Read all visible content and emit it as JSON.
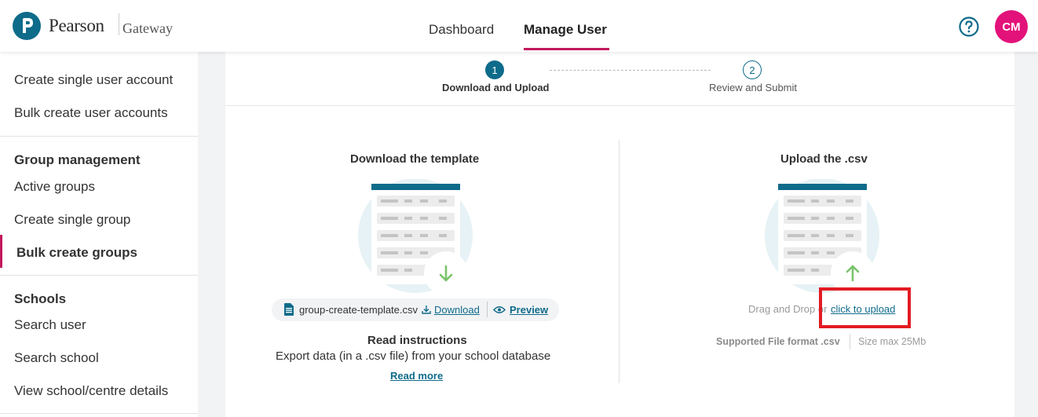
{
  "header": {
    "brand": "Pearson",
    "brand_sub": "Gateway",
    "nav": [
      {
        "label": "Dashboard",
        "active": false
      },
      {
        "label": "Manage User",
        "active": true
      }
    ],
    "avatar_initials": "CM",
    "help_icon": "question-circle-icon",
    "accent_color": "#c2185b",
    "brand_color": "#0f6b8a",
    "avatar_color": "#e3127a"
  },
  "sidebar": {
    "top_items": [
      "Create single user account",
      "Bulk create user accounts"
    ],
    "group_heading": "Group management",
    "group_items": [
      "Active groups",
      "Create single group",
      "Bulk create groups"
    ],
    "active_item": "Bulk create groups",
    "schools_heading": "Schools",
    "school_items": [
      "Search user",
      "Search school",
      "View school/centre details"
    ]
  },
  "stepper": {
    "steps": [
      {
        "number": "1",
        "label": "Download and Upload",
        "current": true
      },
      {
        "number": "2",
        "label": "Review and Submit",
        "current": false
      }
    ]
  },
  "download": {
    "title": "Download the template",
    "file_name": "group-create-template.csv",
    "download_label": "Download",
    "preview_label": "Preview",
    "read_title": "Read instructions",
    "read_desc": "Export data (in a .csv file) from your school database",
    "read_more": "Read more"
  },
  "upload": {
    "title": "Upload the .csv",
    "drag_text": "Drag and Drop or",
    "upload_link": "click to upload",
    "format_text": "Supported File format .csv",
    "size_text": "Size max 25Mb",
    "highlight_color": "#e31b23"
  }
}
